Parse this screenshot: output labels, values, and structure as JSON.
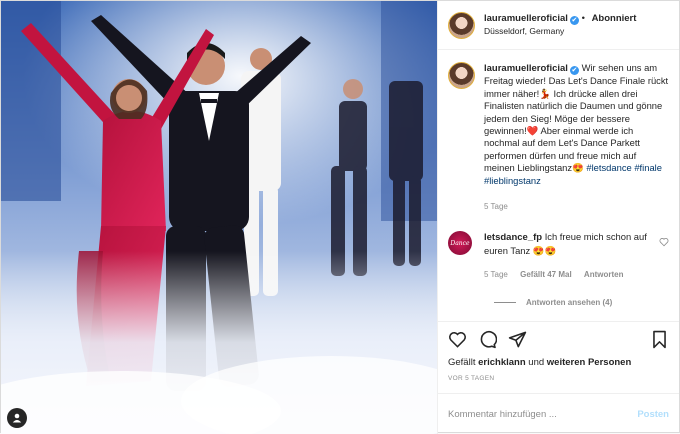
{
  "header": {
    "username": "lauramuelleroficial",
    "verified_icon": "✔",
    "separator": "•",
    "follow_state": "Abonniert",
    "location": "Düsseldorf, Germany"
  },
  "caption": {
    "username": "lauramuelleroficial",
    "text": "Wir sehen uns am Freitag wieder! Das Let's Dance Finale rückt immer näher!💃 Ich drücke allen drei Finalisten natürlich die Daumen und gönne jedem den Sieg! Möge der bessere gewinnen!❤️ Aber einmal werde ich nochmal auf dem Let's Dance Parkett performen dürfen und freue mich auf meinen Lieblingstanz😍",
    "hashtags": "#letsdance #finale #lieblingstanz",
    "age": "5 Tage"
  },
  "reply": {
    "username": "letsdance_fp",
    "avatar_text": "Dance",
    "text": "Ich freue mich schon auf euren Tanz 😍😍",
    "age": "5 Tage",
    "likes": "Gefällt 47 Mal",
    "reply_label": "Antworten",
    "view_replies": "Antworten ansehen (4)"
  },
  "likes": {
    "prefix": "Gefällt",
    "user": "erichklann",
    "connector": "und",
    "others": "weiteren Personen"
  },
  "timestamp": "VOR 5 TAGEN",
  "comment_box": {
    "placeholder": "Kommentar hinzufügen ...",
    "post_label": "Posten"
  },
  "colors": {
    "link": "#00376b",
    "verified": "#3897f0",
    "post_button": "#b2dffc",
    "muted": "#8e8e8e"
  },
  "icons": [
    "heart-icon",
    "comment-icon",
    "share-icon",
    "bookmark-icon",
    "user-tag-icon",
    "verified-icon"
  ]
}
